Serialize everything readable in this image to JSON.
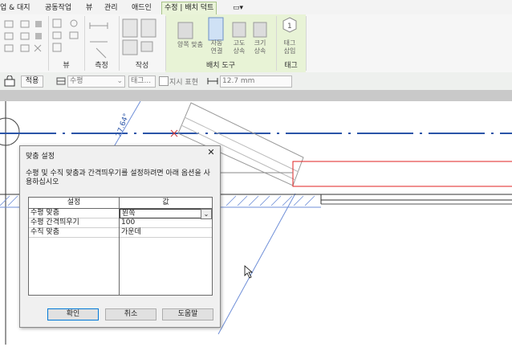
{
  "ribbon": {
    "tabs": [
      "업 & 대지",
      "공동작업",
      "뷰",
      "관리",
      "애드인",
      "수정 | 배치 덕트"
    ],
    "active_tab": "수정 | 배치 덕트",
    "dropdown_glyph": "▭▾",
    "panels": {
      "view": "뷰",
      "measure": "측정",
      "create": "작성",
      "placement": "배치 도구",
      "tag": "태그"
    },
    "buttons": {
      "align_both": [
        "양쪽 맞춤"
      ],
      "auto_connect": [
        "자동",
        "연결"
      ],
      "inherit_elevation": [
        "고도",
        "상속"
      ],
      "inherit_size": [
        "크기",
        "상속"
      ],
      "tag_on_place": [
        "태그",
        "삽입"
      ]
    },
    "tag_glyph": "1"
  },
  "optionsbar": {
    "apply_label": "적용",
    "justification_value": "수평",
    "tag_type_value": "태그...",
    "leader_label": "지시 표현",
    "leader_checked": false,
    "length_value": "12.7 mm"
  },
  "canvas": {
    "angle_dimension": "27.64°"
  },
  "dialog": {
    "title": "맞춤 설정",
    "close_glyph": "✕",
    "description": "수평 및 수직 맞춤과 간격띄우기를 설정하려면 아래 옵션을 사용하십시오",
    "columns": [
      "설정",
      "값"
    ],
    "rows": [
      {
        "setting": "수평 맞춤",
        "value": "왼쪽"
      },
      {
        "setting": "수평 간격띄우기",
        "value": "100"
      },
      {
        "setting": "수직 맞춤",
        "value": "가운데"
      }
    ],
    "buttons": {
      "ok": "확인",
      "cancel": "취소",
      "help": "도움말"
    }
  },
  "colors": {
    "ribbon_context": "#e8f3d6",
    "grid_line": "#2b55a8",
    "selection_red": "#e02020",
    "hatch_blue": "#6f8fd8"
  }
}
